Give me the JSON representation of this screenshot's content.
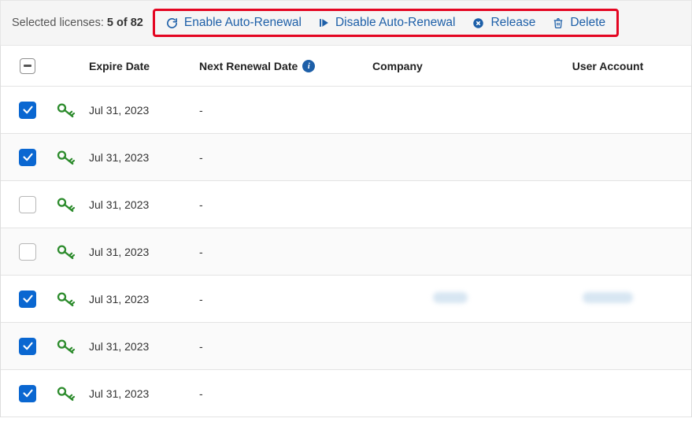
{
  "colors": {
    "primary": "#1d5fa8",
    "highlight_border": "#e40521",
    "checkbox_fill": "#0a67d1",
    "key_icon": "#2C8B2C"
  },
  "toolbar": {
    "selected_prefix": "Selected licenses: ",
    "selected_count": "5",
    "selected_sep": " of ",
    "selected_total": "82",
    "enable_label": "Enable Auto-Renewal",
    "disable_label": "Disable Auto-Renewal",
    "release_label": "Release",
    "delete_label": "Delete"
  },
  "columns": {
    "expire": "Expire Date",
    "renew": "Next Renewal Date",
    "info_tooltip": "i",
    "company": "Company",
    "account": "User Account"
  },
  "rows": [
    {
      "checked": true,
      "expire": "Jul 31, 2023",
      "renew": "-",
      "company": "",
      "account": ""
    },
    {
      "checked": true,
      "expire": "Jul 31, 2023",
      "renew": "-",
      "company": "",
      "account": ""
    },
    {
      "checked": false,
      "expire": "Jul 31, 2023",
      "renew": "-",
      "company": "",
      "account": ""
    },
    {
      "checked": false,
      "expire": "Jul 31, 2023",
      "renew": "-",
      "company": "",
      "account": ""
    },
    {
      "checked": true,
      "expire": "Jul 31, 2023",
      "renew": "-",
      "company": "[blurred]",
      "account": "[blurred]"
    },
    {
      "checked": true,
      "expire": "Jul 31, 2023",
      "renew": "-",
      "company": "",
      "account": ""
    },
    {
      "checked": true,
      "expire": "Jul 31, 2023",
      "renew": "-",
      "company": "",
      "account": ""
    }
  ]
}
